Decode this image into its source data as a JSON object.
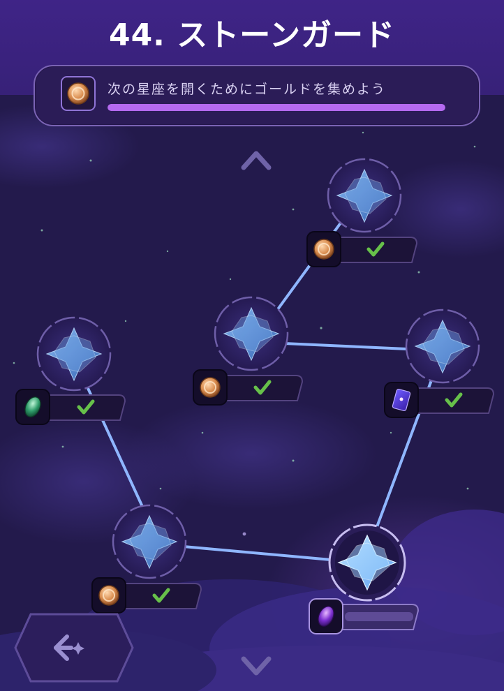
{
  "title": "44. ストーンガード",
  "goal": {
    "text": "次の星座を開くためにゴールドを集めよう",
    "progress": 1.0,
    "icon": "gold-coin-icon"
  },
  "nodes": [
    {
      "id": "top",
      "reward_icon": "gold-coin-icon",
      "status": "completed"
    },
    {
      "id": "middle",
      "reward_icon": "gold-coin-icon",
      "status": "completed"
    },
    {
      "id": "right",
      "reward_icon": "purple-card-icon",
      "status": "completed"
    },
    {
      "id": "left",
      "reward_icon": "green-gem-icon",
      "status": "completed"
    },
    {
      "id": "bottom-left",
      "reward_icon": "gold-coin-icon",
      "status": "completed"
    },
    {
      "id": "bottom-right",
      "reward_icon": "purple-gem-icon",
      "status": "in-progress",
      "progress": 0.0
    }
  ],
  "icons": {
    "check": "check-icon",
    "scroll_up": "chevron-up-icon",
    "scroll_down": "chevron-down-icon",
    "back": "back-sparkle-icon"
  },
  "colors": {
    "background": "#231a4c",
    "header": "#3c2282",
    "connector": "#8fb6ff",
    "check": "#67c04a",
    "accent": "#b56af0"
  }
}
